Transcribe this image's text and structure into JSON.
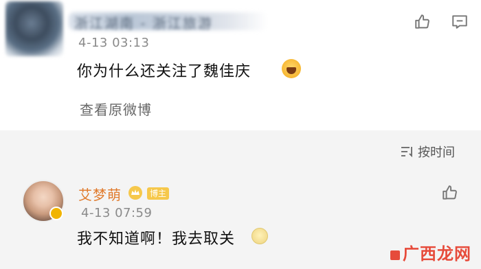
{
  "comment_1": {
    "author_name": "浙江湖南 - 浙江旅游",
    "timestamp": "4-13 03:13",
    "text": "你为什么还关注了魏佳庆",
    "link_label": "查看原微博"
  },
  "sort": {
    "label": "按时间"
  },
  "comment_2": {
    "author_name": "艾梦萌",
    "badge_text": "博主",
    "timestamp": "4-13 07:59",
    "text": "我不知道啊！我去取关"
  },
  "watermark": {
    "text": "广西龙网"
  },
  "colors": {
    "username": "#e07a2c",
    "watermark": "#e64b3b",
    "background_band": "#f4f4f4"
  },
  "icons": [
    "like-icon",
    "reply-icon",
    "sort-icon",
    "crown-icon",
    "laugh-emoji",
    "smile-emoji"
  ]
}
